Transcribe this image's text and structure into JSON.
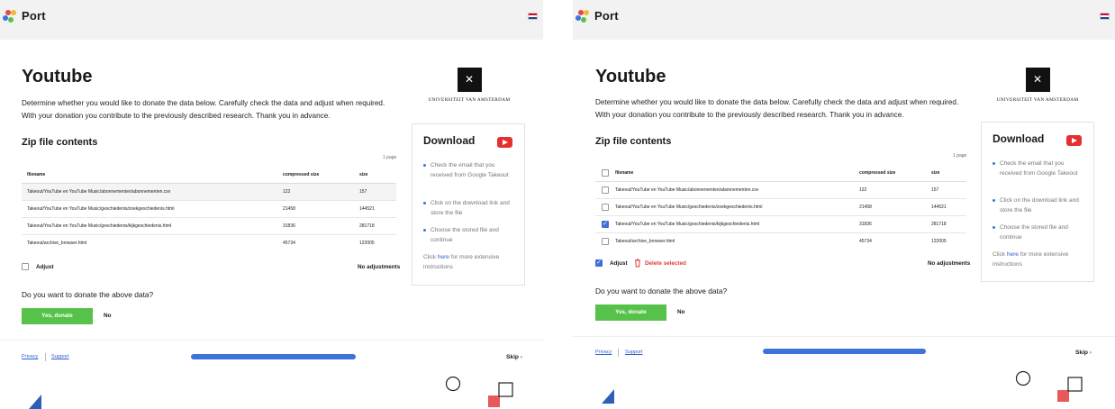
{
  "app": {
    "brand": "Port"
  },
  "page": {
    "title": "Youtube",
    "description_line1": "Determine whether you would like to donate the data below. Carefully check the data and adjust when required.",
    "description_line2": "With your donation you contribute to the previously described research. Thank you in advance."
  },
  "institution": {
    "name": "UNIVERSITEIT VAN AMSTERDAM"
  },
  "table": {
    "title": "Zip file contents",
    "pages": "1 page",
    "columns": [
      "filename",
      "compressed size",
      "size"
    ],
    "rows": [
      {
        "filename": "Takeout/YouTube en YouTube Music/abonnementen/abonnementen.csv",
        "compressed": "122",
        "size": "157"
      },
      {
        "filename": "Takeout/YouTube en YouTube Music/geschiedenis/zoekgeschiedenis.html",
        "compressed": "21458",
        "size": "144521"
      },
      {
        "filename": "Takeout/YouTube en YouTube Music/geschiedenis/kijkgeschiedenis.html",
        "compressed": "31836",
        "size": "281718"
      },
      {
        "filename": "Takeout/archive_browser.html",
        "compressed": "45734",
        "size": "122005"
      }
    ]
  },
  "adjust": {
    "label": "Adjust",
    "status": "No adjustments",
    "delete_label": "Delete selected"
  },
  "donate": {
    "question": "Do you want to donate the above data?",
    "yes": "Yes, donate",
    "no": "No"
  },
  "download_card": {
    "title": "Download",
    "steps": [
      "Check the email that you received from Google Takeout",
      "Click on the download link and store the file",
      "Choose the stored file and continue"
    ],
    "more_prefix": "Click ",
    "more_link": "here",
    "more_suffix": " for more extensive instructions"
  },
  "footer": {
    "privacy": "Privacy",
    "support": "Support",
    "skip": "Skip",
    "skip_arrow": "›",
    "progress_fraction": 0.5
  },
  "states": {
    "left": {
      "adjust_checked": false,
      "selected_rows": []
    },
    "right": {
      "adjust_checked": true,
      "selected_rows": [
        2
      ]
    }
  },
  "colors": {
    "accent_blue": "#3c73dc",
    "donate_green": "#57c24a",
    "delete_red": "#e03a3a",
    "youtube_red": "#e53030",
    "topbar_gray": "#f2f2f2"
  },
  "icons": [
    "port-logo-icon",
    "flag-nl-icon",
    "youtube-icon",
    "trash-icon",
    "checkbox-icon",
    "chevron-right-icon"
  ]
}
